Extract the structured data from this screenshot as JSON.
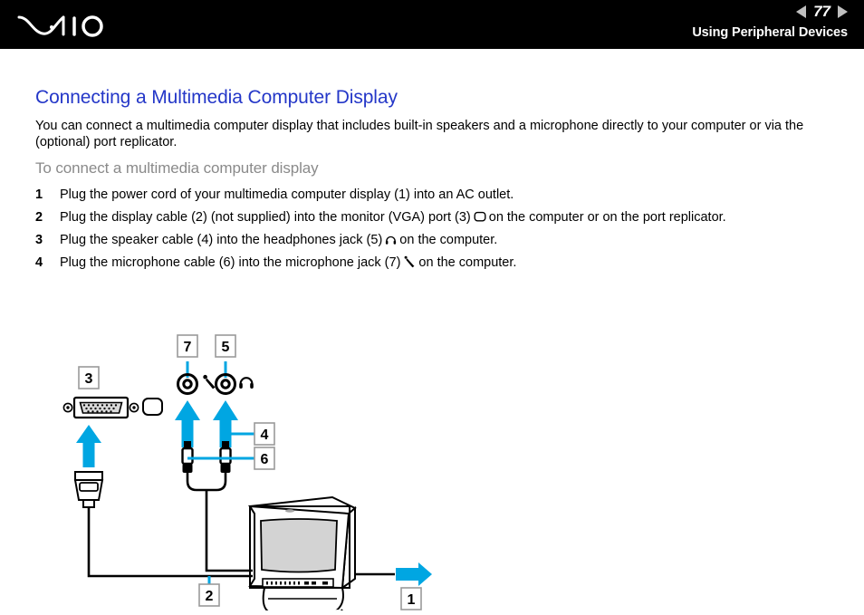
{
  "header": {
    "logo": "VAIO",
    "prev_label": "◀",
    "next_label": "▶",
    "page_number": "77",
    "section": "Using Peripheral Devices",
    "background_color": "#000000"
  },
  "page": {
    "title": "Connecting a Multimedia Computer Display",
    "title_color": "#2437c8",
    "intro": "You can connect a multimedia computer display that includes built-in speakers and a microphone directly to your computer or via the (optional) port replicator.",
    "subtitle": "To connect a multimedia computer display",
    "subtitle_color": "#8a8a8a"
  },
  "steps": [
    {
      "num": "1",
      "text_before": "Plug the power cord of your multimedia computer display (1) into an AC outlet.",
      "icon": "",
      "text_after": ""
    },
    {
      "num": "2",
      "text_before": "Plug the display cable (2) (not supplied) into the monitor (VGA) port (3)",
      "icon": "monitor-port-icon",
      "text_after": "on the computer or on the port replicator."
    },
    {
      "num": "3",
      "text_before": "Plug the speaker cable (4) into the headphones jack (5)",
      "icon": "headphones-icon",
      "text_after": "on the computer."
    },
    {
      "num": "4",
      "text_before": "Plug the microphone cable (6) into the microphone jack (7)",
      "icon": "microphone-icon",
      "text_after": "on the computer."
    }
  ],
  "figure": {
    "accent_color": "#00a6e2",
    "callouts": [
      {
        "id": "callout-7",
        "label": "7"
      },
      {
        "id": "callout-5",
        "label": "5"
      },
      {
        "id": "callout-3",
        "label": "3"
      },
      {
        "id": "callout-4",
        "label": "4"
      },
      {
        "id": "callout-6",
        "label": "6"
      },
      {
        "id": "callout-2",
        "label": "2"
      },
      {
        "id": "callout-1",
        "label": "1"
      }
    ],
    "parts": {
      "vga_port": "vga-port-icon",
      "monitor_symbol": "monitor-symbol-icon",
      "microphone_jack": "microphone-jack-icon",
      "microphone_symbol": "microphone-symbol-icon",
      "headphones_jack": "headphones-jack-icon",
      "headphones_symbol": "headphones-symbol-icon",
      "vga_connector": "vga-connector",
      "audio_plug_left": "audio-plug-microphone",
      "audio_plug_right": "audio-plug-speaker",
      "display_device": "crt-monitor-illustration",
      "power_cord_arrow": "power-cord-arrow"
    }
  }
}
